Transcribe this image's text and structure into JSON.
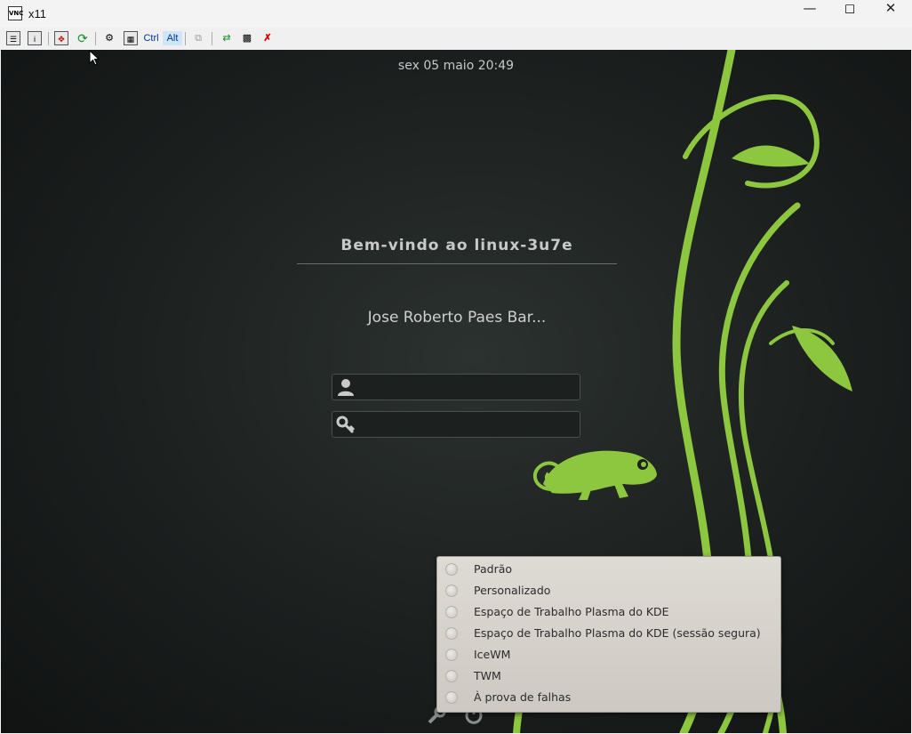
{
  "window": {
    "title": "x11",
    "app_icon_text": "VNC",
    "minimize_icon": "minimize-icon",
    "maximize_icon": "maximize-icon",
    "close_icon": "close-icon"
  },
  "toolbar": {
    "ctrl_label": "Ctrl",
    "alt_label": "Alt",
    "icons": [
      "connection-options-icon",
      "connection-info-icon",
      "fullscreen-icon",
      "refresh-icon",
      "ctrl-alt-del-icon",
      "special-keys-icon",
      "copy-clipboard-icon",
      "transfer-files-icon",
      "save-icon",
      "disconnect-icon"
    ]
  },
  "login": {
    "clock": "sex 05 maio 20:49",
    "welcome": "Bem-vindo ao linux-3u7e",
    "user_display": "Jose Roberto Paes Bar...",
    "username_value": "",
    "password_value": ""
  },
  "session_menu": {
    "items": [
      {
        "label": "Padrão"
      },
      {
        "label": "Personalizado"
      },
      {
        "label": "Espaço de Trabalho Plasma do KDE"
      },
      {
        "label": "Espaço de Trabalho Plasma do KDE (sessão segura)"
      },
      {
        "label": "IceWM"
      },
      {
        "label": "TWM"
      },
      {
        "label": "À prova de falhas"
      }
    ]
  },
  "colors": {
    "accent_green": "#8dc63f",
    "background": "#1b1f1e"
  }
}
